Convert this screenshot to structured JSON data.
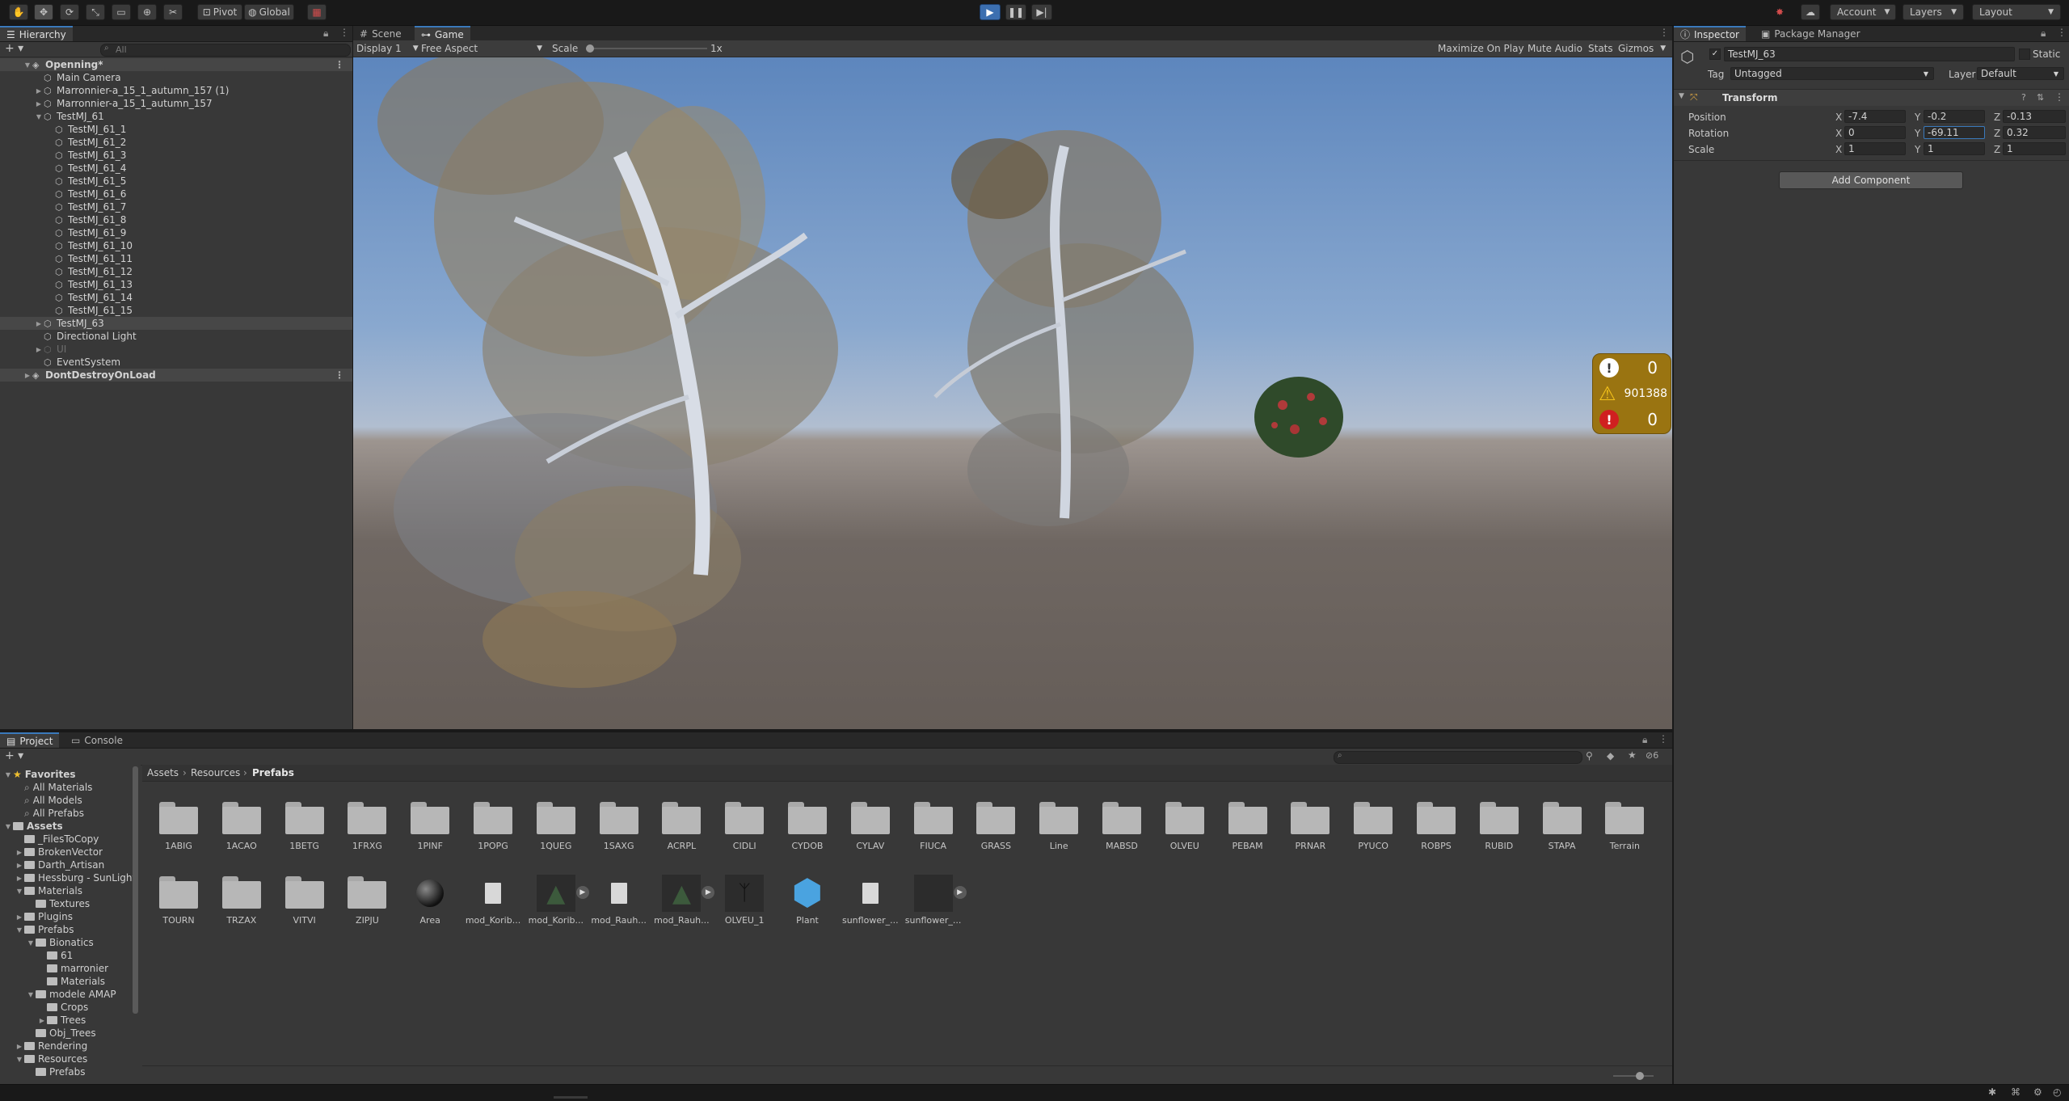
{
  "toolbar": {
    "pivot": "Pivot",
    "global": "Global",
    "account": "Account",
    "layers": "Layers",
    "layout": "Layout"
  },
  "hierarchy": {
    "tab": "Hierarchy",
    "search_placeholder": "All",
    "rows": [
      {
        "label": "Openning*",
        "depth": 0,
        "fold": "open",
        "type": "scene"
      },
      {
        "label": "Main Camera",
        "depth": 1,
        "fold": "none"
      },
      {
        "label": "Marronnier-a_15_1_autumn_157 (1)",
        "depth": 1,
        "fold": "closed"
      },
      {
        "label": "Marronnier-a_15_1_autumn_157",
        "depth": 1,
        "fold": "closed"
      },
      {
        "label": "TestMJ_61",
        "depth": 1,
        "fold": "open"
      },
      {
        "label": "TestMJ_61_1",
        "depth": 2,
        "fold": "none"
      },
      {
        "label": "TestMJ_61_2",
        "depth": 2,
        "fold": "none"
      },
      {
        "label": "TestMJ_61_3",
        "depth": 2,
        "fold": "none"
      },
      {
        "label": "TestMJ_61_4",
        "depth": 2,
        "fold": "none"
      },
      {
        "label": "TestMJ_61_5",
        "depth": 2,
        "fold": "none"
      },
      {
        "label": "TestMJ_61_6",
        "depth": 2,
        "fold": "none"
      },
      {
        "label": "TestMJ_61_7",
        "depth": 2,
        "fold": "none"
      },
      {
        "label": "TestMJ_61_8",
        "depth": 2,
        "fold": "none"
      },
      {
        "label": "TestMJ_61_9",
        "depth": 2,
        "fold": "none"
      },
      {
        "label": "TestMJ_61_10",
        "depth": 2,
        "fold": "none"
      },
      {
        "label": "TestMJ_61_11",
        "depth": 2,
        "fold": "none"
      },
      {
        "label": "TestMJ_61_12",
        "depth": 2,
        "fold": "none"
      },
      {
        "label": "TestMJ_61_13",
        "depth": 2,
        "fold": "none"
      },
      {
        "label": "TestMJ_61_14",
        "depth": 2,
        "fold": "none"
      },
      {
        "label": "TestMJ_61_15",
        "depth": 2,
        "fold": "none"
      },
      {
        "label": "TestMJ_63",
        "depth": 1,
        "fold": "closed",
        "type": "selected"
      },
      {
        "label": "Directional Light",
        "depth": 1,
        "fold": "none"
      },
      {
        "label": "UI",
        "depth": 1,
        "fold": "closed",
        "type": "disabled"
      },
      {
        "label": "EventSystem",
        "depth": 1,
        "fold": "none"
      },
      {
        "label": "DontDestroyOnLoad",
        "depth": 0,
        "fold": "closed",
        "type": "scene"
      }
    ]
  },
  "game": {
    "tabs": [
      "Scene",
      "Game"
    ],
    "display": "Display 1",
    "aspect": "Free Aspect",
    "scale_label": "Scale",
    "scale_value": "1x",
    "scale_slider_fraction": 0.0,
    "maximize": "Maximize On Play",
    "mute": "Mute Audio",
    "stats": "Stats",
    "gizmos": "Gizmos"
  },
  "console_counter": {
    "errors": "0",
    "warnings": "901388",
    "exceptions": "0"
  },
  "inspector": {
    "tabs": [
      "Inspector",
      "Package Manager"
    ],
    "object_name": "TestMJ_63",
    "static_label": "Static",
    "tag_label": "Tag",
    "tag_value": "Untagged",
    "layer_label": "Layer",
    "layer_value": "Default",
    "component": "Transform",
    "position_label": "Position",
    "rotation_label": "Rotation",
    "scale_label": "Scale",
    "position": {
      "x": "-7.4",
      "y": "-0.2",
      "z": "-0.13"
    },
    "rotation": {
      "x": "0",
      "y": "-69.11",
      "z": "0.32"
    },
    "scale": {
      "x": "1",
      "y": "1",
      "z": "1"
    },
    "add_component": "Add Component"
  },
  "project": {
    "tabs": [
      "Project",
      "Console"
    ],
    "hidden_count": "6",
    "breadcrumb": [
      "Assets",
      "Resources",
      "Prefabs"
    ],
    "tree": [
      {
        "label": "Favorites",
        "depth": 0,
        "kind": "fav",
        "fold": "open"
      },
      {
        "label": "All Materials",
        "depth": 1,
        "kind": "search"
      },
      {
        "label": "All Models",
        "depth": 1,
        "kind": "search"
      },
      {
        "label": "All Prefabs",
        "depth": 1,
        "kind": "search"
      },
      {
        "label": "Assets",
        "depth": 0,
        "kind": "folder",
        "fold": "open",
        "bold": true
      },
      {
        "label": "_FilesToCopy",
        "depth": 1,
        "kind": "folder",
        "fold": "none"
      },
      {
        "label": "BrokenVector",
        "depth": 1,
        "kind": "folder",
        "fold": "closed"
      },
      {
        "label": "Darth_Artisan",
        "depth": 1,
        "kind": "folder",
        "fold": "closed"
      },
      {
        "label": "Hessburg - SunLight",
        "depth": 1,
        "kind": "folder",
        "fold": "closed"
      },
      {
        "label": "Materials",
        "depth": 1,
        "kind": "folder",
        "fold": "open"
      },
      {
        "label": "Textures",
        "depth": 2,
        "kind": "folder",
        "fold": "none"
      },
      {
        "label": "Plugins",
        "depth": 1,
        "kind": "folder",
        "fold": "closed"
      },
      {
        "label": "Prefabs",
        "depth": 1,
        "kind": "folder",
        "fold": "open"
      },
      {
        "label": "Bionatics",
        "depth": 2,
        "kind": "folder",
        "fold": "open"
      },
      {
        "label": "61",
        "depth": 3,
        "kind": "folder",
        "fold": "none"
      },
      {
        "label": "marronier",
        "depth": 3,
        "kind": "folder",
        "fold": "none"
      },
      {
        "label": "Materials",
        "depth": 3,
        "kind": "folder",
        "fold": "none"
      },
      {
        "label": "modele AMAP",
        "depth": 2,
        "kind": "folder",
        "fold": "open"
      },
      {
        "label": "Crops",
        "depth": 3,
        "kind": "folder",
        "fold": "none"
      },
      {
        "label": "Trees",
        "depth": 3,
        "kind": "folder",
        "fold": "closed"
      },
      {
        "label": "Obj_Trees",
        "depth": 2,
        "kind": "folder",
        "fold": "none"
      },
      {
        "label": "Rendering",
        "depth": 1,
        "kind": "folder",
        "fold": "closed"
      },
      {
        "label": "Resources",
        "depth": 1,
        "kind": "folder",
        "fold": "open"
      },
      {
        "label": "Prefabs",
        "depth": 2,
        "kind": "folder",
        "fold": "none"
      }
    ],
    "grid_row1": [
      "1ABIG",
      "1ACAO",
      "1BETG",
      "1FRXG",
      "1PINF",
      "1POPG",
      "1QUEG",
      "1SAXG",
      "ACRPL",
      "CIDLI",
      "CYDOB",
      "CYLAV",
      "FIUCA",
      "GRASS",
      "Line",
      "MABSD",
      "OLVEU",
      "PEBAM",
      "PRNAR",
      "PYUCO",
      "ROBPS",
      "RUBID",
      "STAPA",
      "Terrain"
    ],
    "grid_row2": [
      {
        "label": "TOURN",
        "kind": "folder"
      },
      {
        "label": "TRZAX",
        "kind": "folder"
      },
      {
        "label": "VITVI",
        "kind": "folder"
      },
      {
        "label": "ZIPJU",
        "kind": "folder"
      },
      {
        "label": "Area",
        "kind": "sphere"
      },
      {
        "label": "mod_Korib...",
        "kind": "file"
      },
      {
        "label": "mod_Korib...",
        "kind": "tree",
        "play": true
      },
      {
        "label": "mod_Rauh...",
        "kind": "file"
      },
      {
        "label": "mod_Rauh...",
        "kind": "tree",
        "play": true
      },
      {
        "label": "OLVEU_1",
        "kind": "branch"
      },
      {
        "label": "Plant",
        "kind": "cube"
      },
      {
        "label": "sunflower_...",
        "kind": "file"
      },
      {
        "label": "sunflower_...",
        "kind": "dark",
        "play": true
      }
    ]
  },
  "colors": {
    "accent": "#3a79bb",
    "panel": "#383838",
    "dark": "#191919",
    "warning_bg": "#9a7411"
  }
}
